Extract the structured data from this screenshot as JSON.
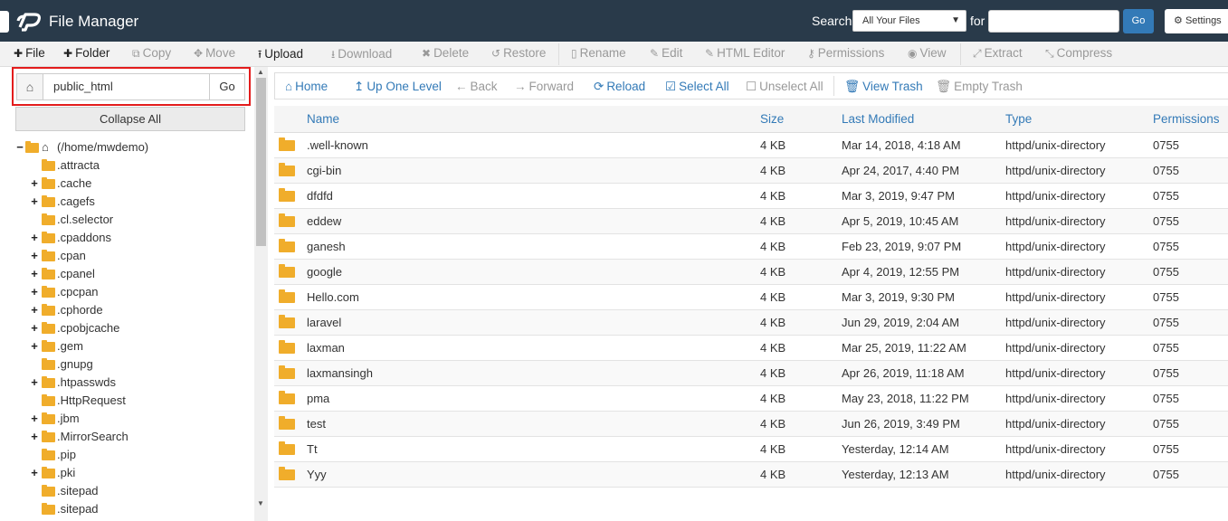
{
  "header": {
    "title": "File Manager",
    "search_label": "Search",
    "search_scope": "All Your Files",
    "for_label": "for",
    "search_value": "",
    "go_label": "Go",
    "settings_label": "Settings"
  },
  "toolbar": {
    "file": "File",
    "folder": "Folder",
    "copy": "Copy",
    "move": "Move",
    "upload": "Upload",
    "download": "Download",
    "delete": "Delete",
    "restore": "Restore",
    "rename": "Rename",
    "edit": "Edit",
    "html_editor": "HTML Editor",
    "permissions": "Permissions",
    "view": "View",
    "extract": "Extract",
    "compress": "Compress"
  },
  "sidebar": {
    "path_value": "public_html",
    "go_label": "Go",
    "collapse_all": "Collapse All",
    "root_label": "(/home/mwdemo)",
    "items": [
      {
        "label": ".attracta",
        "expandable": false
      },
      {
        "label": ".cache",
        "expandable": true
      },
      {
        "label": ".cagefs",
        "expandable": true
      },
      {
        "label": ".cl.selector",
        "expandable": false
      },
      {
        "label": ".cpaddons",
        "expandable": true
      },
      {
        "label": ".cpan",
        "expandable": true
      },
      {
        "label": ".cpanel",
        "expandable": true
      },
      {
        "label": ".cpcpan",
        "expandable": true
      },
      {
        "label": ".cphorde",
        "expandable": true
      },
      {
        "label": ".cpobjcache",
        "expandable": true
      },
      {
        "label": ".gem",
        "expandable": true
      },
      {
        "label": ".gnupg",
        "expandable": false
      },
      {
        "label": ".htpasswds",
        "expandable": true
      },
      {
        "label": ".HttpRequest",
        "expandable": false
      },
      {
        "label": ".jbm",
        "expandable": true
      },
      {
        "label": ".MirrorSearch",
        "expandable": true
      },
      {
        "label": ".pip",
        "expandable": false
      },
      {
        "label": ".pki",
        "expandable": true
      },
      {
        "label": ".sitepad",
        "expandable": false
      },
      {
        "label": ".sitepad",
        "expandable": false
      }
    ]
  },
  "navbar": {
    "home": "Home",
    "up_one_level": "Up One Level",
    "back": "Back",
    "forward": "Forward",
    "reload": "Reload",
    "select_all": "Select All",
    "unselect_all": "Unselect All",
    "view_trash": "View Trash",
    "empty_trash": "Empty Trash"
  },
  "table": {
    "columns": {
      "name": "Name",
      "size": "Size",
      "modified": "Last Modified",
      "type": "Type",
      "perms": "Permissions"
    },
    "rows": [
      {
        "name": ".well-known",
        "size": "4 KB",
        "modified": "Mar 14, 2018, 4:18 AM",
        "type": "httpd/unix-directory",
        "perms": "0755"
      },
      {
        "name": "cgi-bin",
        "size": "4 KB",
        "modified": "Apr 24, 2017, 4:40 PM",
        "type": "httpd/unix-directory",
        "perms": "0755"
      },
      {
        "name": "dfdfd",
        "size": "4 KB",
        "modified": "Mar 3, 2019, 9:47 PM",
        "type": "httpd/unix-directory",
        "perms": "0755"
      },
      {
        "name": "eddew",
        "size": "4 KB",
        "modified": "Apr 5, 2019, 10:45 AM",
        "type": "httpd/unix-directory",
        "perms": "0755"
      },
      {
        "name": "ganesh",
        "size": "4 KB",
        "modified": "Feb 23, 2019, 9:07 PM",
        "type": "httpd/unix-directory",
        "perms": "0755"
      },
      {
        "name": "google",
        "size": "4 KB",
        "modified": "Apr 4, 2019, 12:55 PM",
        "type": "httpd/unix-directory",
        "perms": "0755"
      },
      {
        "name": "Hello.com",
        "size": "4 KB",
        "modified": "Mar 3, 2019, 9:30 PM",
        "type": "httpd/unix-directory",
        "perms": "0755"
      },
      {
        "name": "laravel",
        "size": "4 KB",
        "modified": "Jun 29, 2019, 2:04 AM",
        "type": "httpd/unix-directory",
        "perms": "0755"
      },
      {
        "name": "laxman",
        "size": "4 KB",
        "modified": "Mar 25, 2019, 11:22 AM",
        "type": "httpd/unix-directory",
        "perms": "0755"
      },
      {
        "name": "laxmansingh",
        "size": "4 KB",
        "modified": "Apr 26, 2019, 11:18 AM",
        "type": "httpd/unix-directory",
        "perms": "0755"
      },
      {
        "name": "pma",
        "size": "4 KB",
        "modified": "May 23, 2018, 11:22 PM",
        "type": "httpd/unix-directory",
        "perms": "0755"
      },
      {
        "name": "test",
        "size": "4 KB",
        "modified": "Jun 26, 2019, 3:49 PM",
        "type": "httpd/unix-directory",
        "perms": "0755"
      },
      {
        "name": "Tt",
        "size": "4 KB",
        "modified": "Yesterday, 12:14 AM",
        "type": "httpd/unix-directory",
        "perms": "0755"
      },
      {
        "name": "Yyy",
        "size": "4 KB",
        "modified": "Yesterday, 12:13 AM",
        "type": "httpd/unix-directory",
        "perms": "0755"
      }
    ]
  },
  "colors": {
    "header_bg": "#293a4a",
    "link_blue": "#337ab7",
    "folder": "#f0ad2b",
    "highlight_red": "#e31c1c"
  }
}
